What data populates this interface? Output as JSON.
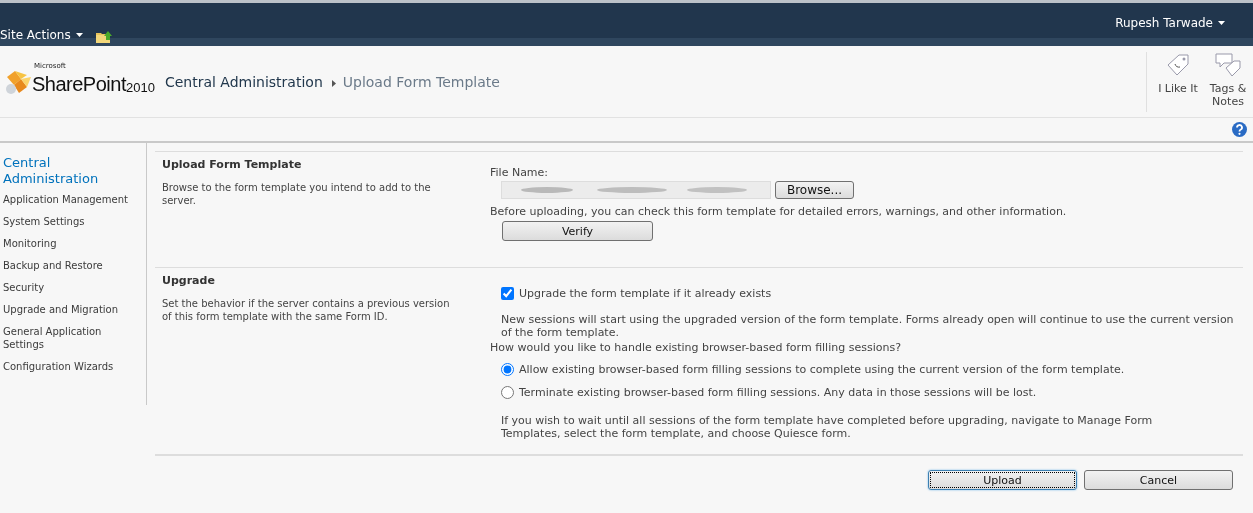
{
  "top_bar": {
    "site_actions": "Site Actions",
    "user": "Rupesh Tarwade"
  },
  "header": {
    "logo": {
      "maker": "Microsoft",
      "product": "SharePoint",
      "version": "2010"
    },
    "breadcrumb": [
      "Central Administration",
      "Upload Form Template"
    ],
    "actions": [
      {
        "kind": "like",
        "label": "I Like It"
      },
      {
        "kind": "tags",
        "label": "Tags & Notes"
      }
    ]
  },
  "sidebar": {
    "items": [
      {
        "kind": "heading",
        "label": "Central Administration"
      },
      {
        "kind": "link",
        "label": "Application Management"
      },
      {
        "kind": "link",
        "label": "System Settings"
      },
      {
        "kind": "link",
        "label": "Monitoring"
      },
      {
        "kind": "link",
        "label": "Backup and Restore"
      },
      {
        "kind": "link",
        "label": "Security"
      },
      {
        "kind": "link",
        "label": "Upgrade and Migration"
      },
      {
        "kind": "link",
        "label": "General Application Settings"
      },
      {
        "kind": "link",
        "label": "Configuration Wizards"
      }
    ]
  },
  "upload_section": {
    "title": "Upload Form Template",
    "description": "Browse to the form template you intend to add to the server.",
    "file_label": "File Name:",
    "browse_button": "Browse...",
    "verify_note": "Before uploading, you can check this form template for detailed errors, warnings, and other information.",
    "verify_button": "Verify"
  },
  "upgrade_section": {
    "title": "Upgrade",
    "description": "Set the behavior if the server contains a previous version of this form template with the same Form ID.",
    "checkbox": {
      "label": "Upgrade the form template if it already exists",
      "checked": true
    },
    "note": "New sessions will start using the upgraded version of the form template. Forms already open will continue to use the current version of the form template.",
    "question": "How would you like to handle existing browser-based form filling sessions?",
    "options": [
      {
        "label": "Allow existing browser-based form filling sessions to complete using the current version of the form template.",
        "selected": true
      },
      {
        "label": "Terminate existing browser-based form filling sessions. Any data in those sessions will be lost.",
        "selected": false
      }
    ],
    "footnote": "If you wish to wait until all sessions of the form template have completed before upgrading, navigate to Manage Form Templates, select the form template, and choose Quiesce form."
  },
  "buttons": [
    {
      "label": "Upload",
      "focused": true
    },
    {
      "label": "Cancel",
      "focused": false
    }
  ]
}
